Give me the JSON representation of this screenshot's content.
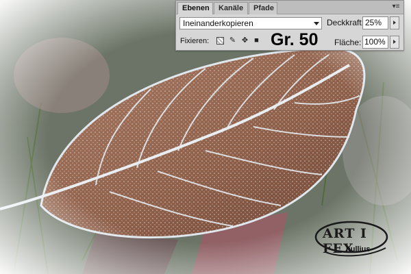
{
  "panel": {
    "tabs": [
      {
        "label": "Ebenen",
        "active": true
      },
      {
        "label": "Kanäle",
        "active": false
      },
      {
        "label": "Pfade",
        "active": false
      }
    ],
    "menu_icon": "panel-menu-icon",
    "blend_mode": "Ineinanderkopieren",
    "opacity_label": "Deckkraft:",
    "opacity_value": "25%",
    "lock_label": "Fixieren:",
    "lock_icons": [
      "lock-transparent-icon",
      "lock-image-icon",
      "lock-position-icon",
      "lock-all-icon"
    ],
    "fill_label": "Fläche:",
    "fill_value": "100%"
  },
  "overlay_text": "Gr. 50",
  "logo": {
    "text": "ART I FEX",
    "subtext": "nullius"
  },
  "colors": {
    "panel_bg": "#d6d6d6",
    "tab_bar": "#bdbdbd",
    "leaf_brown": "#8a5a44",
    "frost": "#e8eef4",
    "grass": "#3f5a2c"
  }
}
